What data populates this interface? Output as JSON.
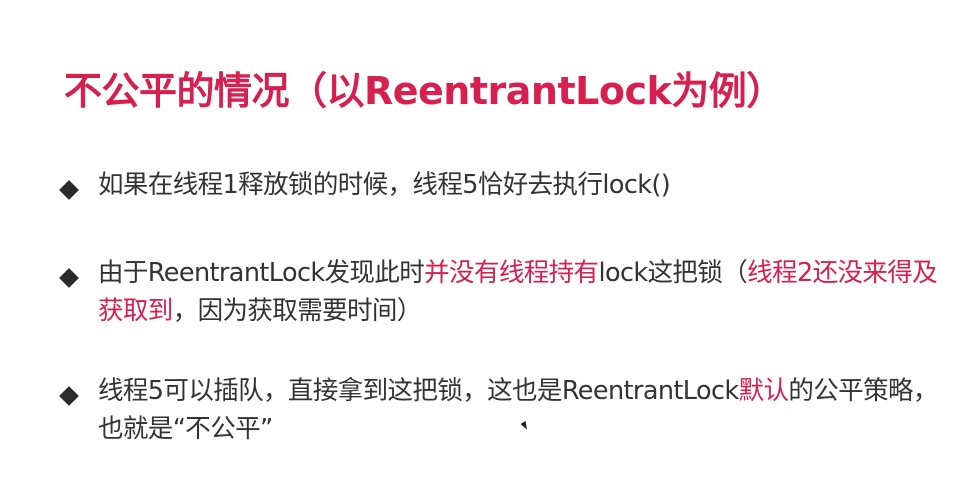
{
  "title": "不公平的情况（以ReentrantLock为例）",
  "bullets": [
    {
      "segments": [
        {
          "text": "如果在线程1释放锁的时候，线程5恰好去执行lock()",
          "highlight": false
        }
      ]
    },
    {
      "segments": [
        {
          "text": "由于ReentrantLock发现此时",
          "highlight": false
        },
        {
          "text": "并没有线程持有",
          "highlight": true
        },
        {
          "text": "lock这把锁（",
          "highlight": false
        },
        {
          "text": "线程2还没来得及获取到",
          "highlight": true
        },
        {
          "text": "，因为获取需要时间）",
          "highlight": false
        }
      ]
    },
    {
      "segments": [
        {
          "text": "线程5可以插队，直接拿到这把锁，这也是ReentrantLock",
          "highlight": false
        },
        {
          "text": "默认",
          "highlight": true
        },
        {
          "text": "的公平策略，也就是“不公平”",
          "highlight": false
        }
      ]
    }
  ],
  "colors": {
    "accent": "#d6204f",
    "text": "#333333",
    "marker": "#2b2b2b"
  },
  "icons": {
    "bullet_marker": "diamond-bullet-icon",
    "cursor": "mouse-cursor-icon"
  }
}
